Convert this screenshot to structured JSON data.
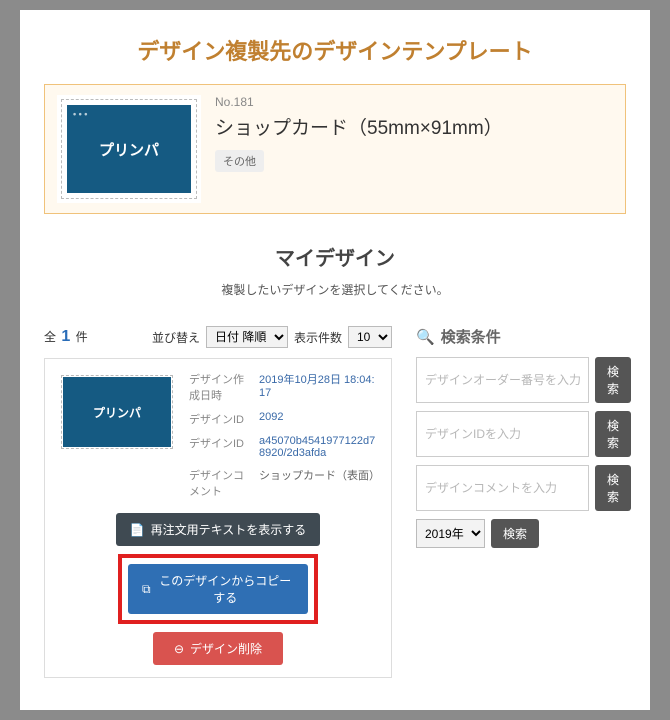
{
  "page_title": "デザイン複製先のデザインテンプレート",
  "template": {
    "no_label": "No.181",
    "name": "ショップカード（55mm×91mm）",
    "category_badge": "その他",
    "thumb_text": "プリンパ"
  },
  "mydesign": {
    "title": "マイデザイン",
    "instruction": "複製したいデザインを選択してください。"
  },
  "list": {
    "total_prefix": "全",
    "total_suffix": "件",
    "total_count": "1",
    "sort_label": "並び替え",
    "sort_options": [
      "日付 降順"
    ],
    "per_page_label": "表示件数",
    "per_page_options": [
      "10"
    ]
  },
  "design_item": {
    "thumb_text": "プリンパ",
    "fields": {
      "created_label": "デザイン作成日時",
      "created_value": "2019年10月28日 18:04:17",
      "design_id_label": "デザインID",
      "design_id_value": "2092",
      "design_id2_label": "デザインID",
      "design_id2_value": "a45070b4541977122d78920/2d3afda",
      "comment_label": "デザインコメント",
      "comment_value": "ショップカード（表面）"
    },
    "actions": {
      "reorder_text": "再注文用テキストを表示する",
      "copy_text": "このデザインからコピーする",
      "delete_text": "デザイン削除"
    }
  },
  "search": {
    "title": "検索条件",
    "order_no_placeholder": "デザインオーダー番号を入力",
    "design_id_placeholder": "デザインIDを入力",
    "comment_placeholder": "デザインコメントを入力",
    "year_options": [
      "2019年"
    ],
    "search_button": "検索"
  },
  "icons": {
    "search": "🔍",
    "file": "📄",
    "copy": "⧉",
    "minus": "⊖"
  }
}
